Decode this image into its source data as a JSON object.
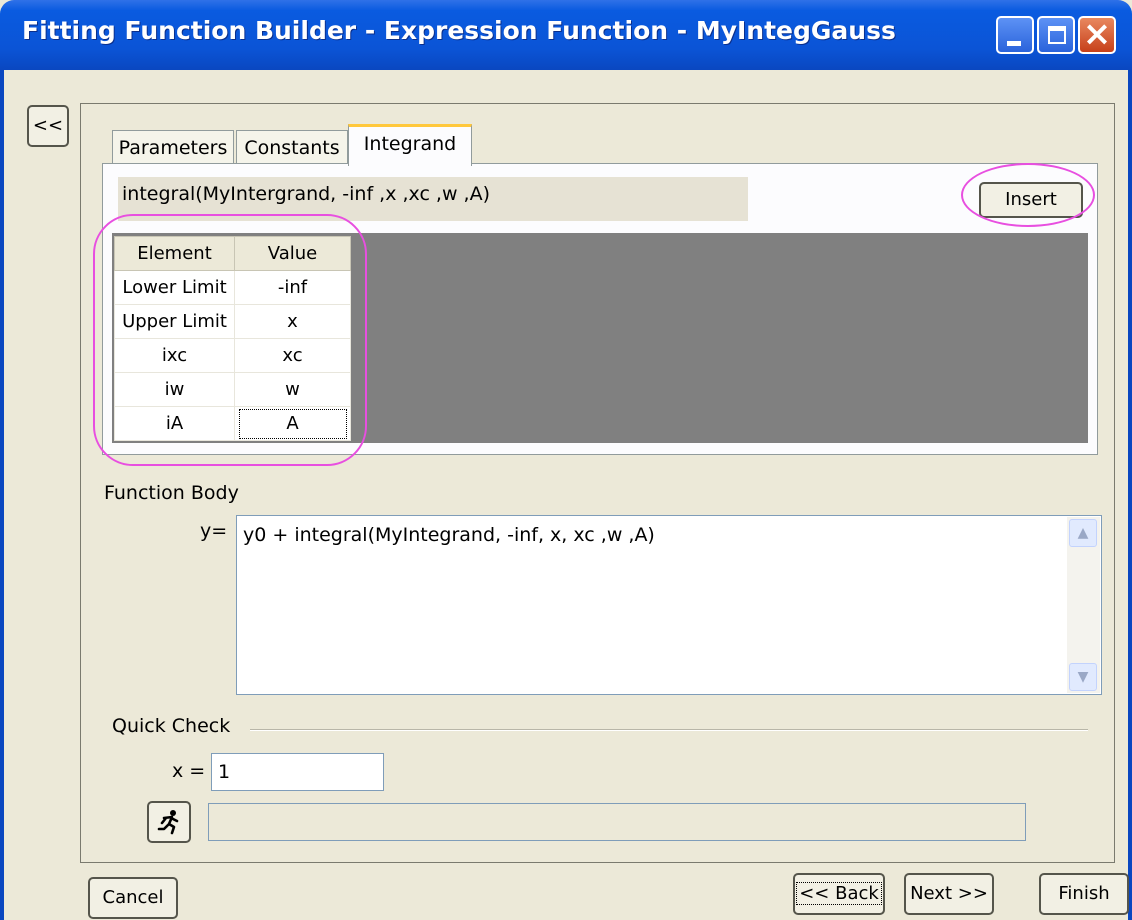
{
  "window": {
    "title": "Fitting Function Builder - Expression Function - MyIntegGauss",
    "close_glyph": "×"
  },
  "collapse_label": "<<",
  "tabs": [
    {
      "label": "Parameters",
      "active": false
    },
    {
      "label": "Constants",
      "active": false
    },
    {
      "label": "Integrand",
      "active": true
    }
  ],
  "integrand": {
    "expression": "integral(MyIntergrand, -inf ,x ,xc ,w ,A)",
    "insert_label": "Insert",
    "columns": [
      "Element",
      "Value"
    ],
    "rows": [
      {
        "element": "Lower Limit",
        "value": "-inf"
      },
      {
        "element": "Upper Limit",
        "value": "x"
      },
      {
        "element": "ixc",
        "value": "xc"
      },
      {
        "element": "iw",
        "value": "w"
      },
      {
        "element": "iA",
        "value": "A"
      }
    ]
  },
  "function_body": {
    "label": "Function Body",
    "y_label": "y=",
    "text": "y0 + integral(MyIntegrand, -inf, x, xc ,w ,A)"
  },
  "quick_check": {
    "label": "Quick Check",
    "x_label": "x =",
    "x_value": "1",
    "run_icon": "running-man-icon",
    "result": ""
  },
  "buttons": {
    "cancel": "Cancel",
    "back": "<< Back",
    "next": "Next >>",
    "finish": "Finish"
  },
  "colors": {
    "titlebar": "#0B54D6",
    "dialog_bg": "#ECE9D8",
    "highlight_oval": "#E84FE0",
    "grid_background": "#808080",
    "active_tab_accent": "#FFC83C"
  }
}
